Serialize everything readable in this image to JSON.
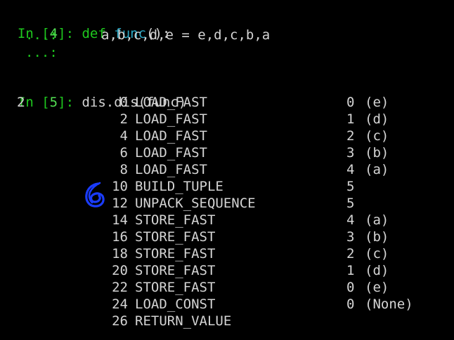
{
  "theme": {
    "background": "#000000",
    "text": "#d4d4d4",
    "prompt_green": "#1ec81e",
    "prompt_teal": "#2aa7c4",
    "annotation_blue": "#1a3cff"
  },
  "cell4": {
    "prompt_in": "In",
    "prompt_bracket_open": " [",
    "prompt_num": "4",
    "prompt_bracket_close": "]:",
    "keyword": "def",
    "funcname": "func",
    "rest": "():",
    "cont1": "...:",
    "body": "a,b,c,d,e = e,d,c,b,a",
    "cont2": "...:"
  },
  "cell5": {
    "prompt_in": "In",
    "prompt_bracket_open": " [",
    "prompt_num": "5",
    "prompt_bracket_close": "]:",
    "code": "dis.dis(func)"
  },
  "disassembly": {
    "line_number": "2",
    "rows": [
      {
        "offset": "0",
        "op": "LOAD_FAST",
        "arg": "0",
        "detail": "(e)"
      },
      {
        "offset": "2",
        "op": "LOAD_FAST",
        "arg": "1",
        "detail": "(d)"
      },
      {
        "offset": "4",
        "op": "LOAD_FAST",
        "arg": "2",
        "detail": "(c)"
      },
      {
        "offset": "6",
        "op": "LOAD_FAST",
        "arg": "3",
        "detail": "(b)"
      },
      {
        "offset": "8",
        "op": "LOAD_FAST",
        "arg": "4",
        "detail": "(a)"
      },
      {
        "offset": "10",
        "op": "BUILD_TUPLE",
        "arg": "5",
        "detail": ""
      },
      {
        "offset": "12",
        "op": "UNPACK_SEQUENCE",
        "arg": "5",
        "detail": ""
      },
      {
        "offset": "14",
        "op": "STORE_FAST",
        "arg": "4",
        "detail": "(a)"
      },
      {
        "offset": "16",
        "op": "STORE_FAST",
        "arg": "3",
        "detail": "(b)"
      },
      {
        "offset": "18",
        "op": "STORE_FAST",
        "arg": "2",
        "detail": "(c)"
      },
      {
        "offset": "20",
        "op": "STORE_FAST",
        "arg": "1",
        "detail": "(d)"
      },
      {
        "offset": "22",
        "op": "STORE_FAST",
        "arg": "0",
        "detail": "(e)"
      },
      {
        "offset": "24",
        "op": "LOAD_CONST",
        "arg": "0",
        "detail": "(None)"
      },
      {
        "offset": "26",
        "op": "RETURN_VALUE",
        "arg": "",
        "detail": ""
      }
    ]
  },
  "annotation": {
    "icon": "hand-drawn-circle-icon"
  }
}
